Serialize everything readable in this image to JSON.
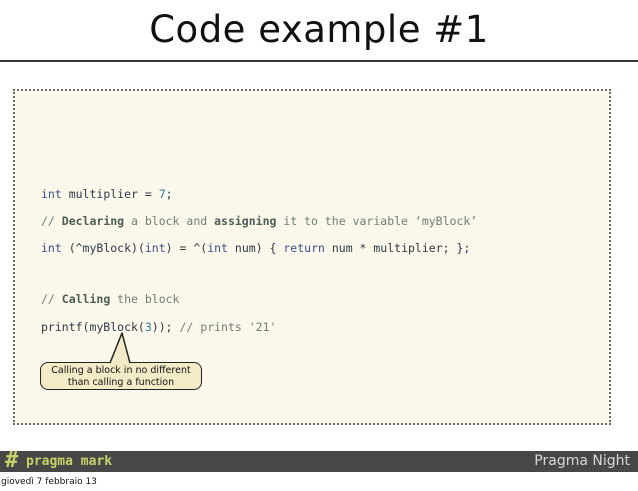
{
  "slide": {
    "title": "Code example #1",
    "code_lines": [
      {
        "id": "line1",
        "parts": [
          {
            "text": "int",
            "style": "kw"
          },
          {
            "text": " multiplier = ",
            "style": "plain"
          },
          {
            "text": "7",
            "style": "num"
          },
          {
            "text": ";",
            "style": "plain"
          }
        ]
      },
      {
        "id": "line2",
        "parts": [
          {
            "text": "// ",
            "style": "cm"
          },
          {
            "text": "Declaring",
            "style": "cmb"
          },
          {
            "text": " a block and ",
            "style": "cm"
          },
          {
            "text": "assigning",
            "style": "cmb"
          },
          {
            "text": " it to the variable ‘myBlock’",
            "style": "cm"
          }
        ]
      },
      {
        "id": "line3",
        "parts": [
          {
            "text": "int",
            "style": "kw"
          },
          {
            "text": " (^myBlock)(",
            "style": "plain"
          },
          {
            "text": "int",
            "style": "kw"
          },
          {
            "text": ") = ^(",
            "style": "plain"
          },
          {
            "text": "int",
            "style": "kw"
          },
          {
            "text": " num) { ",
            "style": "plain"
          },
          {
            "text": "return",
            "style": "kw"
          },
          {
            "text": " num * multiplier; };",
            "style": "plain"
          }
        ]
      },
      {
        "id": "line4",
        "parts": [
          {
            "text": "// ",
            "style": "cm"
          },
          {
            "text": "Calling",
            "style": "cmb"
          },
          {
            "text": " the block",
            "style": "cm"
          }
        ]
      },
      {
        "id": "line5",
        "parts": [
          {
            "text": "printf(myBlock(",
            "style": "plain"
          },
          {
            "text": "3",
            "style": "num"
          },
          {
            "text": ")); ",
            "style": "plain"
          },
          {
            "text": "// prints '21'",
            "style": "cm"
          }
        ]
      }
    ],
    "callout": {
      "line1": "Calling a block in no different",
      "line2": "than calling a function"
    }
  },
  "footer": {
    "logo_hash": "#",
    "logo_text": "pragma mark",
    "brand": "Pragma Night"
  },
  "date_label": "giovedì 7 febbraio 13",
  "colors": {
    "footer_bg": "#474747",
    "logo_accent": "#c8d26a",
    "code_bg": "#fbf7ea",
    "callout_bg": "#f3eac8"
  }
}
